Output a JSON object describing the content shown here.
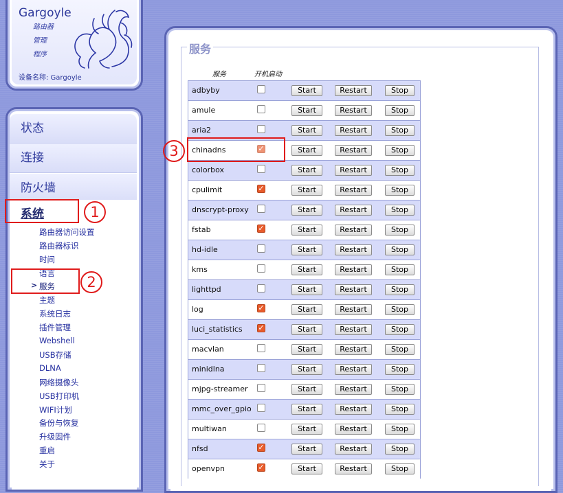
{
  "header": {
    "brand": "Gargoyle",
    "sub_lines": [
      "路由器",
      "管理",
      "程序"
    ],
    "device_name_label": "设备名称: Gargoyle"
  },
  "nav": {
    "main_items": [
      "状态",
      "连接",
      "防火墙",
      "系统"
    ],
    "sub_items": [
      "路由器访问设置",
      "路由器标识",
      "时间",
      "语言",
      "服务",
      "主题",
      "系统日志",
      "插件管理",
      "Webshell",
      "USB存储",
      "DLNA",
      "网络摄像头",
      "USB打印机",
      "WIFI计划",
      "备份与恢复",
      "升级固件",
      "重启",
      "关于"
    ],
    "current_marker": ">"
  },
  "main": {
    "legend": "服务",
    "col_service": "服务",
    "col_boot": "开机启动",
    "btn_start": "Start",
    "btn_restart": "Restart",
    "btn_stop": "Stop",
    "services": [
      {
        "name": "adbyby",
        "enabled": false
      },
      {
        "name": "amule",
        "enabled": false
      },
      {
        "name": "aria2",
        "enabled": false
      },
      {
        "name": "chinadns",
        "enabled": true
      },
      {
        "name": "colorbox",
        "enabled": false
      },
      {
        "name": "cpulimit",
        "enabled": true
      },
      {
        "name": "dnscrypt-proxy",
        "enabled": false
      },
      {
        "name": "fstab",
        "enabled": true
      },
      {
        "name": "hd-idle",
        "enabled": false
      },
      {
        "name": "kms",
        "enabled": false
      },
      {
        "name": "lighttpd",
        "enabled": false
      },
      {
        "name": "log",
        "enabled": true
      },
      {
        "name": "luci_statistics",
        "enabled": true
      },
      {
        "name": "macvlan",
        "enabled": false
      },
      {
        "name": "minidlna",
        "enabled": false
      },
      {
        "name": "mjpg-streamer",
        "enabled": false
      },
      {
        "name": "mmc_over_gpio",
        "enabled": false
      },
      {
        "name": "multiwan",
        "enabled": false
      },
      {
        "name": "nfsd",
        "enabled": true
      },
      {
        "name": "openvpn",
        "enabled": true
      }
    ]
  },
  "annotations": [
    "1",
    "2",
    "3"
  ],
  "colors": {
    "accent": "#2f3a9c",
    "annotation": "#e01b1b",
    "checked": "#e85c2c",
    "row_alt": "#d7dbfa"
  }
}
